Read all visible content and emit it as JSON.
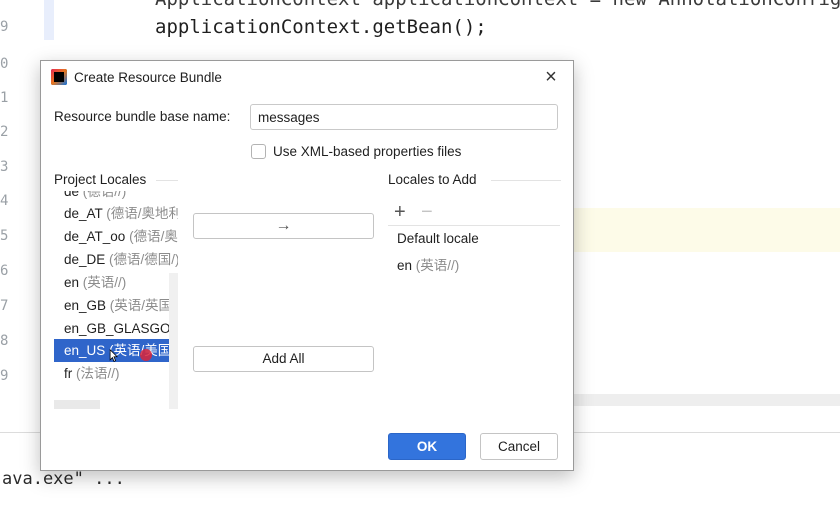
{
  "editor": {
    "gutter_numbers": [
      "9",
      "0",
      "1",
      "2",
      "3",
      "4",
      "5",
      "6",
      "7",
      "8",
      "9"
    ],
    "code_partial": "ApplicationContext applicationContext = new AnnotationConfigAp",
    "code_line": "applicationContext.getBean();",
    "console_text": "ava.exe\" ..."
  },
  "dialog": {
    "title": "Create Resource Bundle",
    "app_icon": "intellij-icon",
    "close_icon": "×",
    "base_name_label": "Resource bundle base name:",
    "base_name_value": "messages",
    "xml_checkbox_label": "Use XML-based properties files",
    "xml_checkbox_checked": false,
    "project_locales_title": "Project Locales",
    "locales_to_add_title": "Locales to Add",
    "project_locales": [
      {
        "code": "de",
        "hint": "(德语//)"
      },
      {
        "code": "de_AT",
        "hint": "(德语/奥地利)"
      },
      {
        "code": "de_AT_oo",
        "hint": "(德语/奥地利/oo)"
      },
      {
        "code": "de_DE",
        "hint": "(德语/德国/)"
      },
      {
        "code": "en",
        "hint": "(英语//)"
      },
      {
        "code": "en_GB",
        "hint": "(英语/英国/)"
      },
      {
        "code": "en_GB_GLASGOW",
        "hint": ""
      },
      {
        "code": "en_US",
        "hint": "(英语/美国/)"
      },
      {
        "code": "fr",
        "hint": "(法语//)"
      }
    ],
    "selected_locale": "en_US",
    "move_right_icon": "→",
    "add_all_label": "Add All",
    "add_icon": "+",
    "remove_icon": "−",
    "locales_to_add": [
      {
        "code": "Default locale",
        "hint": ""
      },
      {
        "code": "en",
        "hint": "(英语//)"
      }
    ],
    "ok_label": "OK",
    "cancel_label": "Cancel"
  },
  "colors": {
    "accent": "#3374dd",
    "selection": "#2f65ca",
    "hint_text": "#8c8c8c"
  }
}
